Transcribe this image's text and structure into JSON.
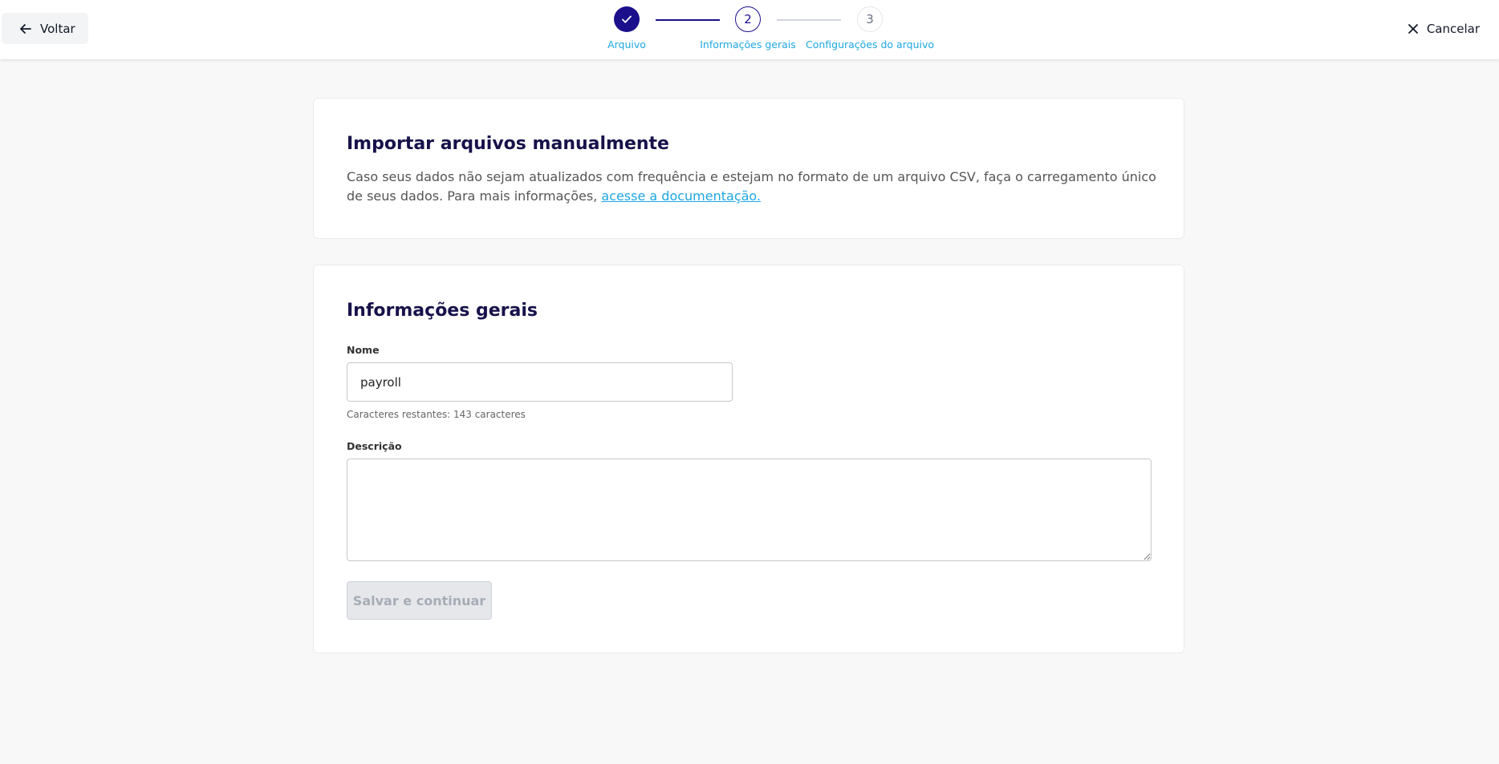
{
  "header": {
    "back_label": "Voltar",
    "cancel_label": "Cancelar",
    "steps": [
      {
        "number": "",
        "label": "Arquivo",
        "status": "completed"
      },
      {
        "number": "2",
        "label": "Informações gerais",
        "status": "current"
      },
      {
        "number": "3",
        "label": "Configurações do arquivo",
        "status": "upcoming"
      }
    ]
  },
  "intro": {
    "title": "Importar arquivos manualmente",
    "text": "Caso seus dados não sejam atualizados com frequência e estejam no formato de um arquivo CSV, faça o carregamento único de seus dados. Para mais informações, ",
    "link_text": "acesse a documentação."
  },
  "form": {
    "title": "Informações gerais",
    "name_label": "Nome",
    "name_value": "payroll",
    "name_hint": "Caracteres restantes: 143 caracteres",
    "description_label": "Descrição",
    "description_value": "",
    "save_label": "Salvar e continuar"
  },
  "colors": {
    "primary": "#1c0f8c",
    "accent": "#1ea7e1",
    "background": "#f8f8f8"
  }
}
